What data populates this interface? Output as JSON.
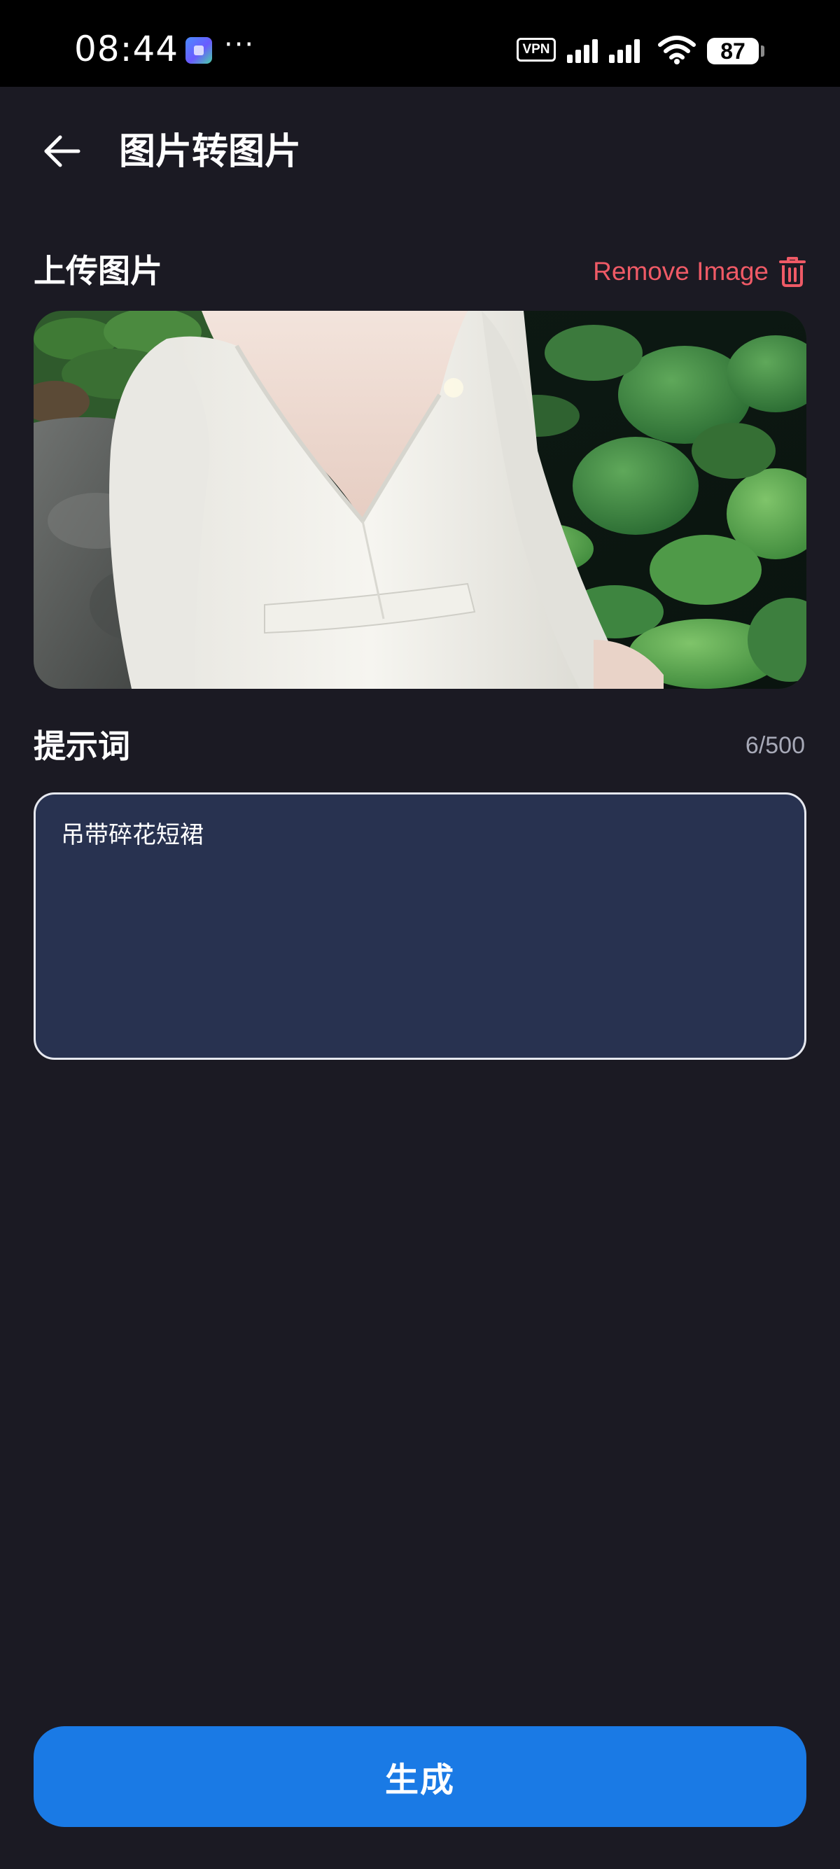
{
  "status_bar": {
    "time": "08:44",
    "more_indicator": "···",
    "vpn_label": "VPN",
    "battery_level": "87",
    "icons": [
      "app-notification-icon",
      "vpn-icon",
      "signal-icon",
      "signal-icon",
      "wifi-icon",
      "battery-icon"
    ]
  },
  "header": {
    "title": "图片转图片",
    "back_icon": "arrow-left-icon"
  },
  "upload": {
    "label": "上传图片",
    "remove_label": "Remove Image",
    "remove_icon": "trash-icon",
    "image_description_icon": "uploaded-photo"
  },
  "prompt": {
    "label": "提示词",
    "counter": "6/500",
    "value": "吊带碎花短裙"
  },
  "generate": {
    "label": "生成"
  },
  "colors": {
    "background": "#1b1a23",
    "accent_blue": "#1a7ae5",
    "remove_red": "#ef5a66",
    "input_fill": "#283250",
    "counter_gray": "#a7a9b7"
  }
}
